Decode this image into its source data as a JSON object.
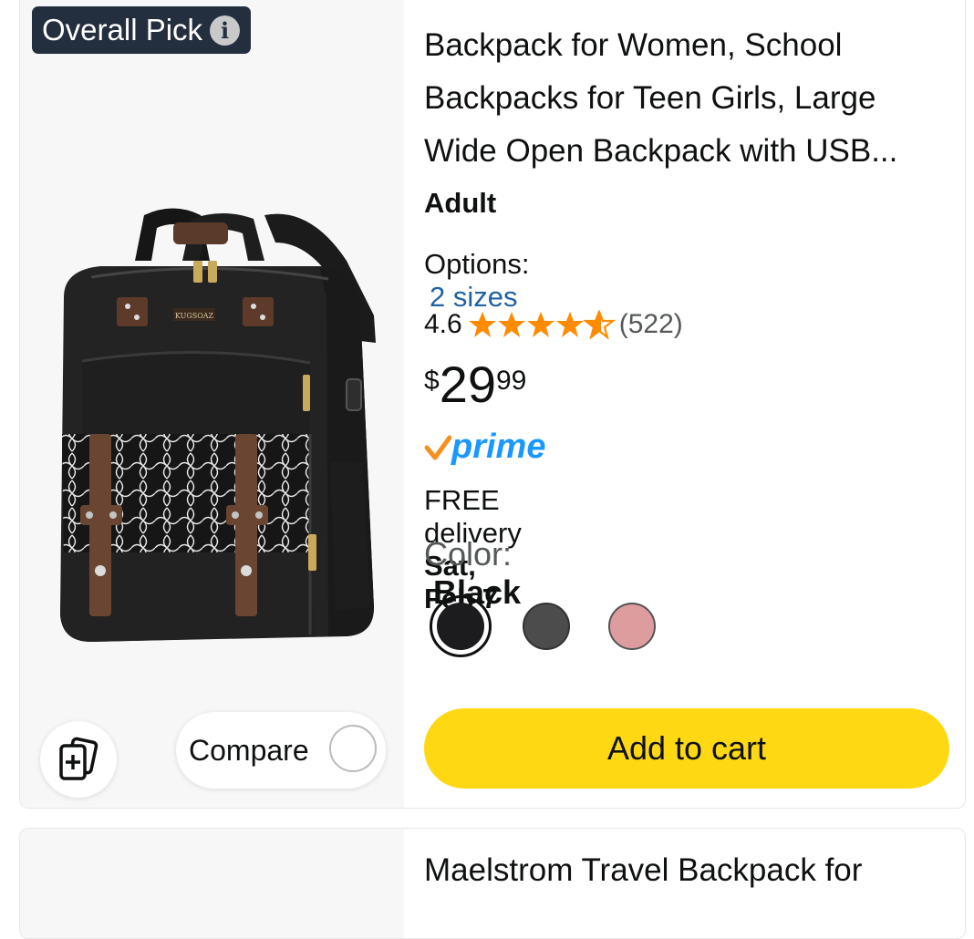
{
  "product": {
    "badge": "Overall Pick",
    "badge_info_icon": "info-icon",
    "title": "Backpack for Women, School Backpacks for Teen Girls, Large Wide Open Backpack with USB...",
    "audience": "Adult",
    "options_label": "Options:",
    "options_link": "2 sizes",
    "rating_value": "4.6",
    "rating_stars": 4.5,
    "review_count": "(522)",
    "price_symbol": "$",
    "price_whole": "29",
    "price_fraction": "99",
    "prime_label": "prime",
    "delivery_prefix": "FREE delivery",
    "delivery_date": "Sat, Feb 7",
    "color_label": "Color:",
    "color_value": "Black",
    "swatches": [
      {
        "name": "Black",
        "color": "#1c1c1e",
        "selected": true
      },
      {
        "name": "Gray",
        "color": "#4c4c4c",
        "selected": false
      },
      {
        "name": "Pink",
        "color": "#dd9d9f",
        "selected": false
      }
    ],
    "compare_label": "Compare",
    "add_to_cart": "Add to cart",
    "image_label": "KUGSOAZ"
  },
  "next_product": {
    "title": "Maelstrom Travel Backpack for"
  },
  "colors": {
    "star": "#ff8c00",
    "link": "#2162a1",
    "prime_check": "#f78f20",
    "prime_word": "#1a98ff",
    "cart_button": "#ffd814",
    "badge_bg": "#232f3e"
  }
}
